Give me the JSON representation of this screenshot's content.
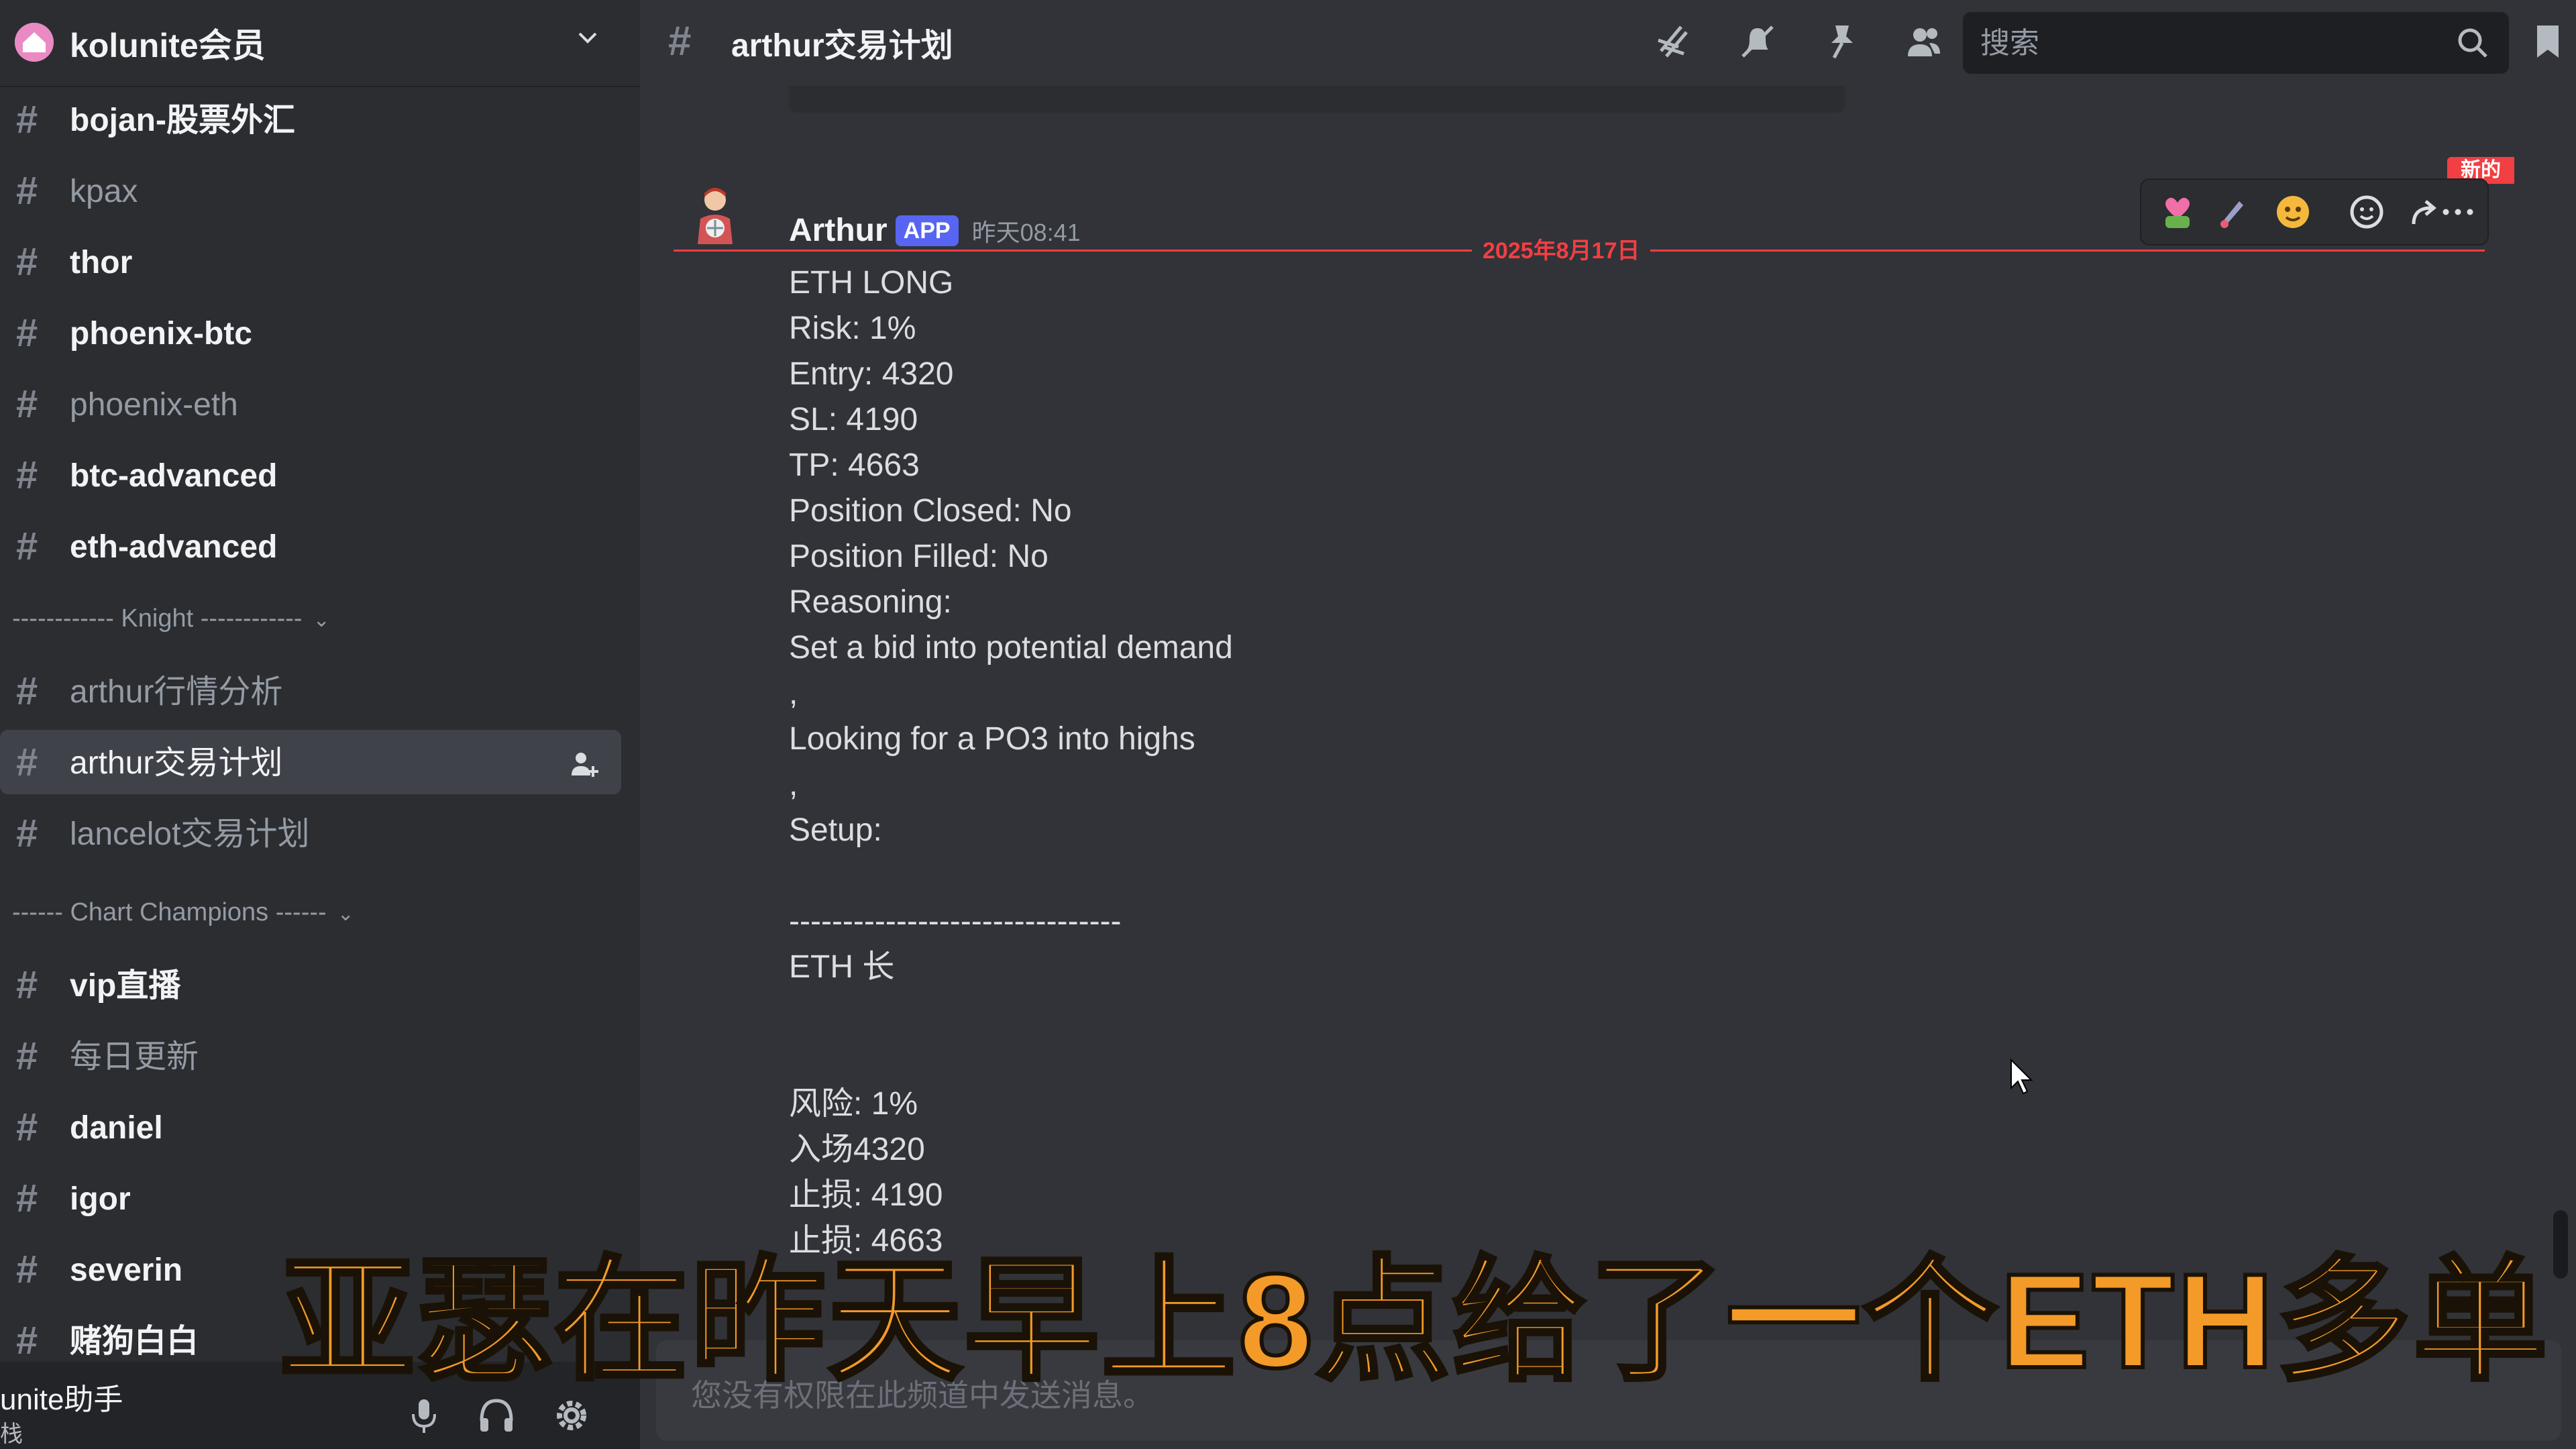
{
  "server": {
    "name": "kolunite会员"
  },
  "sidebar": {
    "channels_top": [
      {
        "label": "bojan-股票外汇",
        "style": "bright"
      },
      {
        "label": "kpax",
        "style": "muted"
      },
      {
        "label": "thor",
        "style": "bright"
      },
      {
        "label": "phoenix-btc",
        "style": "bright"
      },
      {
        "label": "phoenix-eth",
        "style": "muted"
      },
      {
        "label": "btc-advanced",
        "style": "bright"
      },
      {
        "label": "eth-advanced",
        "style": "bright"
      }
    ],
    "category_knight": "------------ Knight ------------",
    "channels_knight": [
      {
        "label": "arthur行情分析",
        "style": "muted"
      },
      {
        "label": "arthur交易计划",
        "style": "selected"
      },
      {
        "label": "lancelot交易计划",
        "style": "muted"
      }
    ],
    "category_champions": "------ Chart Champions ------",
    "channels_champions": [
      {
        "label": "vip直播",
        "style": "bright"
      },
      {
        "label": "每日更新",
        "style": "muted"
      },
      {
        "label": "daniel",
        "style": "bright"
      },
      {
        "label": "igor",
        "style": "bright"
      },
      {
        "label": "severin",
        "style": "bright"
      },
      {
        "label": "赌狗白白",
        "style": "bright"
      }
    ]
  },
  "user_panel": {
    "name": "unite助手",
    "status": "栈"
  },
  "header": {
    "channel_name": "arthur交易计划",
    "icons": [
      "threads-icon",
      "mute-bell-icon",
      "pin-icon",
      "members-icon",
      "bookmark-icon"
    ]
  },
  "search": {
    "placeholder": "搜索"
  },
  "divider": {
    "date": "2025年8月17日",
    "new_label": "新的"
  },
  "message": {
    "author": "Arthur",
    "tag": "APP",
    "timestamp": "昨天08:41",
    "lines": [
      "ETH LONG",
      "Risk: 1%",
      "Entry: 4320",
      "SL: 4190",
      "TP: 4663",
      "Position Closed: No",
      "Position Filled: No",
      "Reasoning:",
      "Set a bid into potential demand",
      ",",
      "Looking for a PO3 into highs",
      ",",
      "Setup:",
      "",
      "-------------------------------",
      "ETH 长",
      "",
      "",
      "风险: 1%",
      "入场4320",
      "止损:   4190",
      "止损:   4663"
    ]
  },
  "composer": {
    "placeholder": "您没有权限在此频道中发送消息。"
  },
  "subtitle": "亚瑟在昨天早上8点给了一个ETH多单",
  "colors": {
    "accent_red": "#f23f43",
    "app_tag": "#5865f2",
    "subtitle": "#f39a28"
  }
}
